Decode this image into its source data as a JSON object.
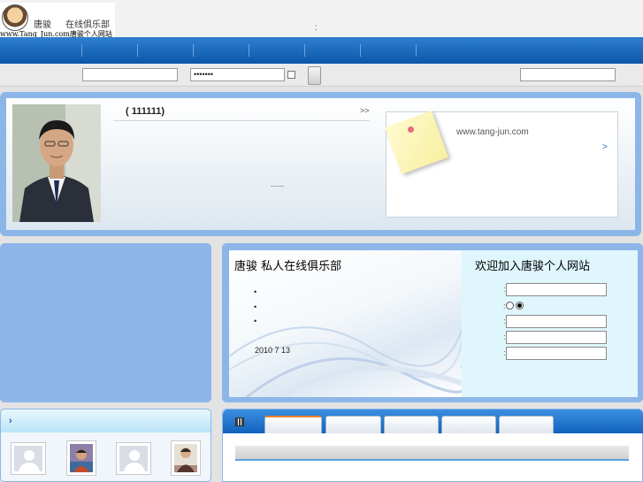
{
  "header": {
    "logo_name": "唐骏",
    "logo_tagline": "在线俱乐部",
    "logo_url": "www.Tang_Jun.com唐骏个人网站",
    "separator": ":"
  },
  "login": {
    "username_value": "",
    "password_value": "•••••••",
    "search_value": ""
  },
  "profile": {
    "title": "(     111111)",
    "more_link": ">>",
    "ellipsis": "......",
    "note_url": "www.tang-jun.com",
    "note_arrow": ">"
  },
  "club": {
    "title": "唐骏  私人在线俱乐部",
    "bullets": [
      "•",
      "•",
      "•"
    ],
    "date": "2010 7 13",
    "welcome": "欢迎加入唐骏个人网站",
    "colon": ":"
  },
  "friends": {
    "header_arrow": "›"
  },
  "icons": {
    "logo": "portrait-logo-icon",
    "friends_header": "chevron-right-icon",
    "tabs_header": "grid-icon",
    "note": "sticky-note-icon",
    "default_avatar": "user-silhouette-icon"
  },
  "colors": {
    "nav_blue": "#0c56a8",
    "panel_blue": "#8db6e8",
    "club_right_bg": "#dff6fd",
    "active_tab_accent": "#f08030"
  }
}
